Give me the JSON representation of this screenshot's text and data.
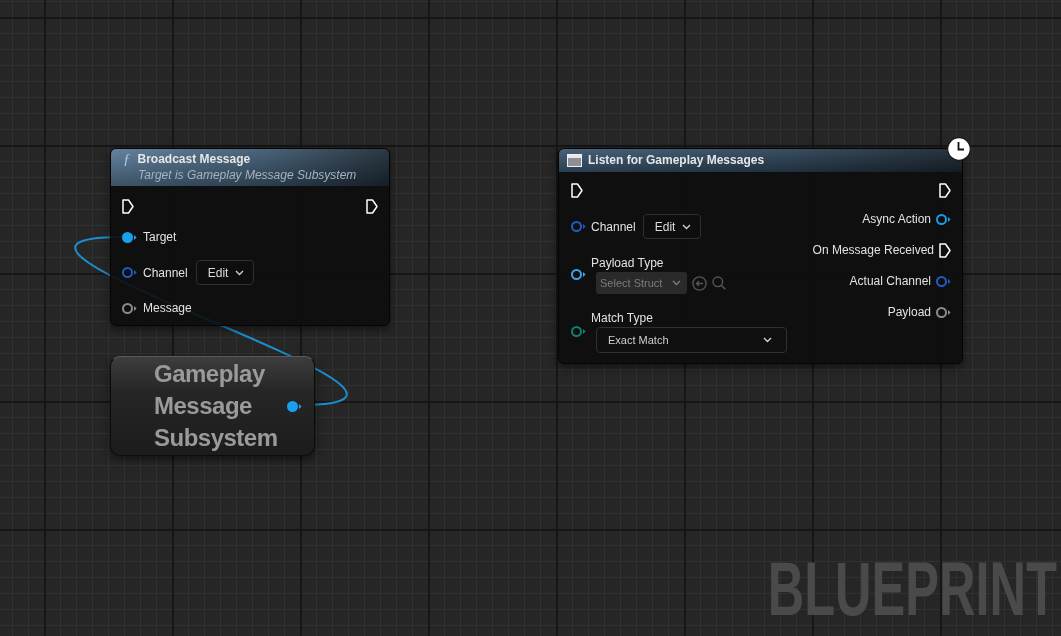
{
  "nodes": [
    {
      "kind": "function",
      "icon": "ƒ",
      "title": "Broadcast Message",
      "subtitle": "Target is Gameplay Message Subsystem",
      "inputs": [
        {
          "kind": "exec",
          "connected": false
        },
        {
          "kind": "data",
          "label": "Target",
          "color": "#1aa1ec",
          "connected": true
        },
        {
          "kind": "data",
          "label": "Channel",
          "color": "#1f5cc6",
          "connected": false,
          "widget": {
            "kind": "tag",
            "value": "Edit",
            "disabled": false
          }
        },
        {
          "kind": "data",
          "label": "Message",
          "color": "#8c8c8c",
          "connected": false
        }
      ],
      "outputs": [
        {
          "kind": "exec",
          "connected": false
        }
      ]
    },
    {
      "kind": "variable",
      "title": "Gameplay Message Subsystem",
      "outputs": [
        {
          "kind": "data",
          "color": "#1aa1ec",
          "connected": true
        }
      ]
    },
    {
      "kind": "async",
      "title": "Listen for Gameplay Messages",
      "inputs": [
        {
          "kind": "exec",
          "connected": false
        },
        {
          "kind": "data",
          "label": "Channel",
          "color": "#1f5cc6",
          "connected": false,
          "widget": {
            "kind": "tag",
            "value": "Edit",
            "disabled": false
          }
        },
        {
          "kind": "data",
          "label": "Payload Type",
          "color": "#3aa6e6",
          "connected": false,
          "widget": {
            "kind": "class_picker",
            "placeholder": "Select Struct",
            "disabled": true
          }
        },
        {
          "kind": "data",
          "label": "Match Type",
          "color": "#13806e",
          "connected": false,
          "widget": {
            "kind": "enum",
            "value": "Exact Match",
            "disabled": false
          }
        }
      ],
      "outputs": [
        {
          "kind": "exec",
          "connected": false
        },
        {
          "kind": "data",
          "label": "Async Action",
          "color": "#1a9be6",
          "connected": false
        },
        {
          "kind": "exec",
          "label": "On Message Received",
          "connected": false
        },
        {
          "kind": "data",
          "label": "Actual Channel",
          "color": "#1f5cc6",
          "connected": false
        },
        {
          "kind": "data",
          "label": "Payload",
          "color": "#8c8c8c",
          "connected": false
        }
      ]
    }
  ],
  "graph_label": "BLUEPRINT"
}
